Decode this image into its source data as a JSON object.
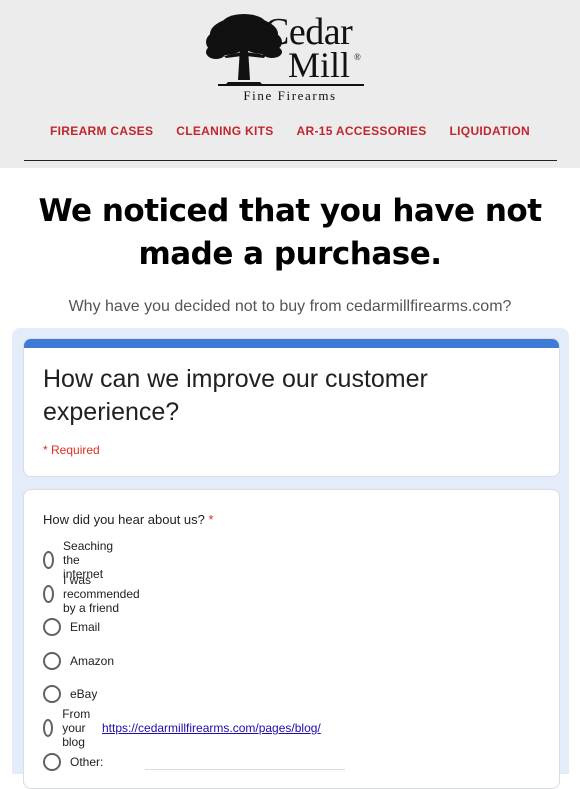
{
  "brand": {
    "name_line1": "Cedar",
    "name_line2": "Mill",
    "registered": "®",
    "tagline": "Fine Firearms",
    "logo_icon": "tree-icon"
  },
  "nav": {
    "items": [
      {
        "label": "FIREARM CASES"
      },
      {
        "label": "CLEANING KITS"
      },
      {
        "label": "AR-15 ACCESSORIES"
      },
      {
        "label": "LIQUIDATION"
      }
    ]
  },
  "headline": "We noticed that you have not made a purchase.",
  "subline": "Why have you decided not to buy from cedarmillfirearms.com?",
  "form": {
    "title": "How can we improve our customer experience?",
    "required_note": "* Required",
    "question": "How did you hear about us?",
    "question_required_mark": "*",
    "options": [
      {
        "label": "Seaching the internet"
      },
      {
        "label": "I was recommended by a friend"
      },
      {
        "label": "Email"
      },
      {
        "label": "Amazon"
      },
      {
        "label": "eBay"
      },
      {
        "label": "From your blog",
        "link": "https://cedarmillfirearms.com/pages/blog/"
      },
      {
        "label": "Other:"
      }
    ]
  },
  "colors": {
    "nav_accent": "#c0272d",
    "form_accent": "#3e7bd6",
    "form_background": "#e4ecf9",
    "required": "#d93025",
    "header_background": "#ececec"
  }
}
